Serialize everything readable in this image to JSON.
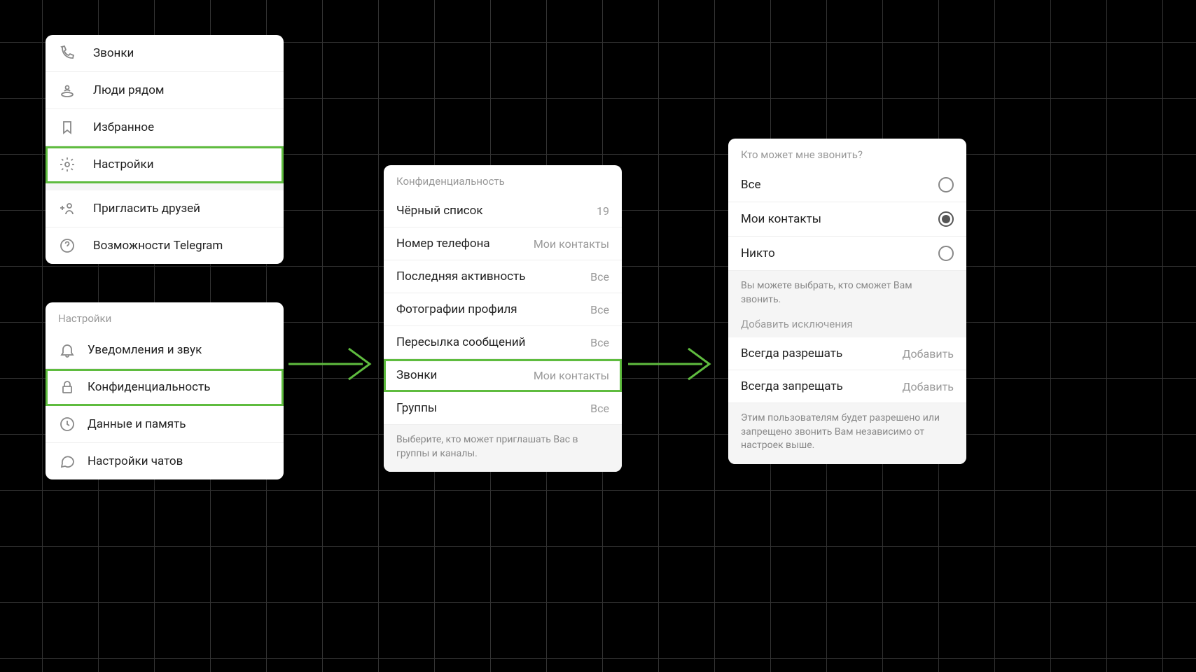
{
  "menu": {
    "items": [
      {
        "label": "Звонки"
      },
      {
        "label": "Люди рядом"
      },
      {
        "label": "Избранное"
      },
      {
        "label": "Настройки"
      },
      {
        "label": "Пригласить друзей"
      },
      {
        "label": "Возможности Telegram"
      }
    ]
  },
  "settings": {
    "header": "Настройки",
    "items": [
      {
        "label": "Уведомления и звук"
      },
      {
        "label": "Конфиденциальность"
      },
      {
        "label": "Данные и память"
      },
      {
        "label": "Настройки чатов"
      }
    ]
  },
  "privacy": {
    "header": "Конфиденциальность",
    "rows": [
      {
        "label": "Чёрный список",
        "value": "19"
      },
      {
        "label": "Номер телефона",
        "value": "Мои контакты"
      },
      {
        "label": "Последняя активность",
        "value": "Все"
      },
      {
        "label": "Фотографии профиля",
        "value": "Все"
      },
      {
        "label": "Пересылка сообщений",
        "value": "Все"
      },
      {
        "label": "Звонки",
        "value": "Мои контакты"
      },
      {
        "label": "Группы",
        "value": "Все"
      }
    ],
    "footer": "Выберите, кто может приглашать Вас в группы и каналы."
  },
  "calls": {
    "header": "Кто может мне звонить?",
    "options": [
      {
        "label": "Все",
        "checked": false
      },
      {
        "label": "Мои контакты",
        "checked": true
      },
      {
        "label": "Никто",
        "checked": false
      }
    ],
    "hint": "Вы можете выбрать, кто сможет Вам звонить.",
    "exceptions_header": "Добавить исключения",
    "exceptions": [
      {
        "label": "Всегда разрешать",
        "action": "Добавить"
      },
      {
        "label": "Всегда запрещать",
        "action": "Добавить"
      }
    ],
    "exceptions_hint": "Этим пользователям будет разрешено или запрещено звонить Вам независимо от настроек выше."
  }
}
